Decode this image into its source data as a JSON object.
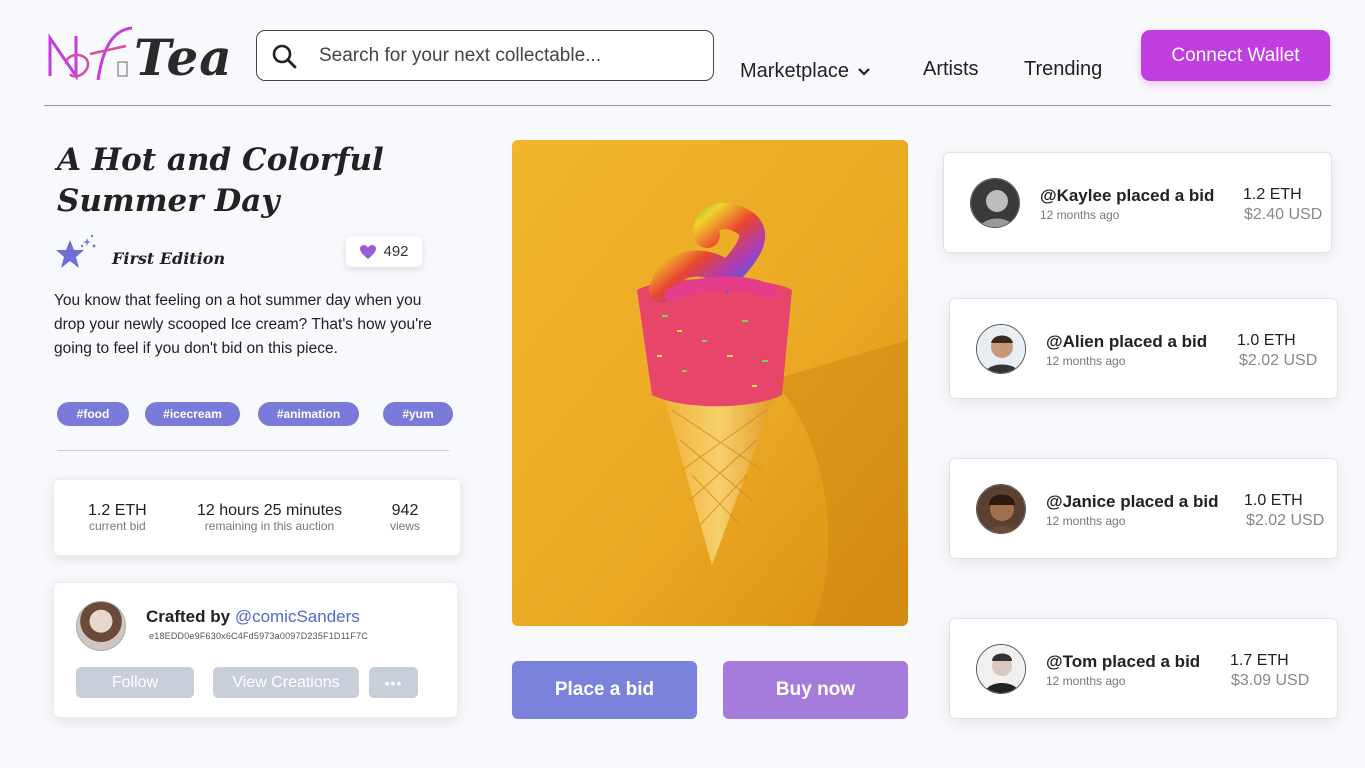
{
  "header": {
    "logo_text": "NfTea",
    "search_placeholder": "Search for your next collectable...",
    "nav": [
      {
        "label": "Marketplace",
        "has_dropdown": true
      },
      {
        "label": "Artists"
      },
      {
        "label": "Trending"
      }
    ],
    "connect_label": "Connect Wallet"
  },
  "colors": {
    "accent": "#c13fe0",
    "tag": "#7a7ad8",
    "bid": "#7b82dc",
    "buy": "#a57cdc"
  },
  "item": {
    "title": "A Hot and Colorful Summer Day",
    "edition": "First Edition",
    "likes": "492",
    "description": "You know that feeling on a hot summer day when you drop your newly scooped Ice cream? That's how you're going to feel if you don't bid on this piece.",
    "tags": [
      "#food",
      "#icecream",
      "#animation",
      "#yum"
    ],
    "stats": [
      {
        "value": "1.2 ETH",
        "label": "current bid"
      },
      {
        "value": "12 hours 25 minutes",
        "label": "remaining in this auction"
      },
      {
        "value": "942",
        "label": "views"
      }
    ]
  },
  "creator": {
    "prefix": "Crafted by",
    "handle": "@comicSanders",
    "hash": "e18EDD0e9F630x6C4Fd5973a0097D235F1D11F7C",
    "follow_label": "Follow",
    "view_label": "View Creations",
    "more_label": "•••"
  },
  "actions": {
    "bid_label": "Place a bid",
    "buy_label": "Buy now"
  },
  "bids": [
    {
      "who": "@Kaylee placed a bid",
      "when": "12 months ago",
      "eth": "1.2 ETH",
      "usd": "$2.40 USD"
    },
    {
      "who": "@Alien placed a bid",
      "when": "12 months ago",
      "eth": "1.0 ETH",
      "usd": "$2.02 USD"
    },
    {
      "who": "@Janice placed a bid",
      "when": "12 months ago",
      "eth": "1.0 ETH",
      "usd": "$2.02 USD"
    },
    {
      "who": "@Tom placed a bid",
      "when": "12 months ago",
      "eth": "1.7 ETH",
      "usd": "$3.09 USD"
    }
  ]
}
